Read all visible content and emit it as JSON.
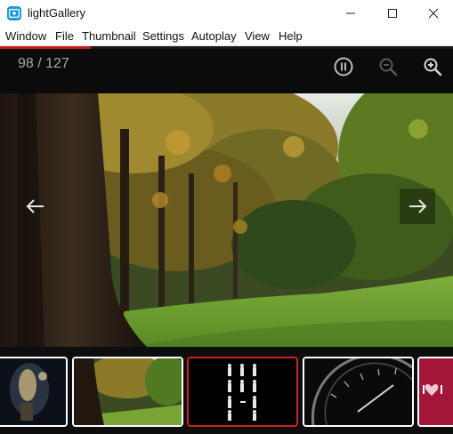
{
  "window": {
    "title": "lightGallery",
    "app_icon": "lightgallery-app-icon",
    "controls": [
      "minimize-icon",
      "maximize-icon",
      "close-icon"
    ]
  },
  "menu": {
    "items": [
      "Window",
      "File",
      "Thumbnail",
      "Settings",
      "Autoplay",
      "View",
      "Help"
    ]
  },
  "progress": {
    "value": 0.2,
    "color": "#c41c1c"
  },
  "gallery": {
    "counter": "98 / 127",
    "toolbar_icons": [
      "pause-icon",
      "zoom-out-icon",
      "zoom-in-icon"
    ],
    "nav_icons": [
      "arrow-left-icon",
      "arrow-right-icon"
    ],
    "grid_toggle_icon": "grid-icon",
    "active_thumb_color": "#c62323",
    "thumbnails": [
      {
        "subject": "dark abstract",
        "active": false
      },
      {
        "subject": "autumn forest",
        "active": false
      },
      {
        "subject": "sign language chart",
        "active": true
      },
      {
        "subject": "speedometer",
        "active": false
      },
      {
        "subject": "red love",
        "active": false
      }
    ]
  }
}
